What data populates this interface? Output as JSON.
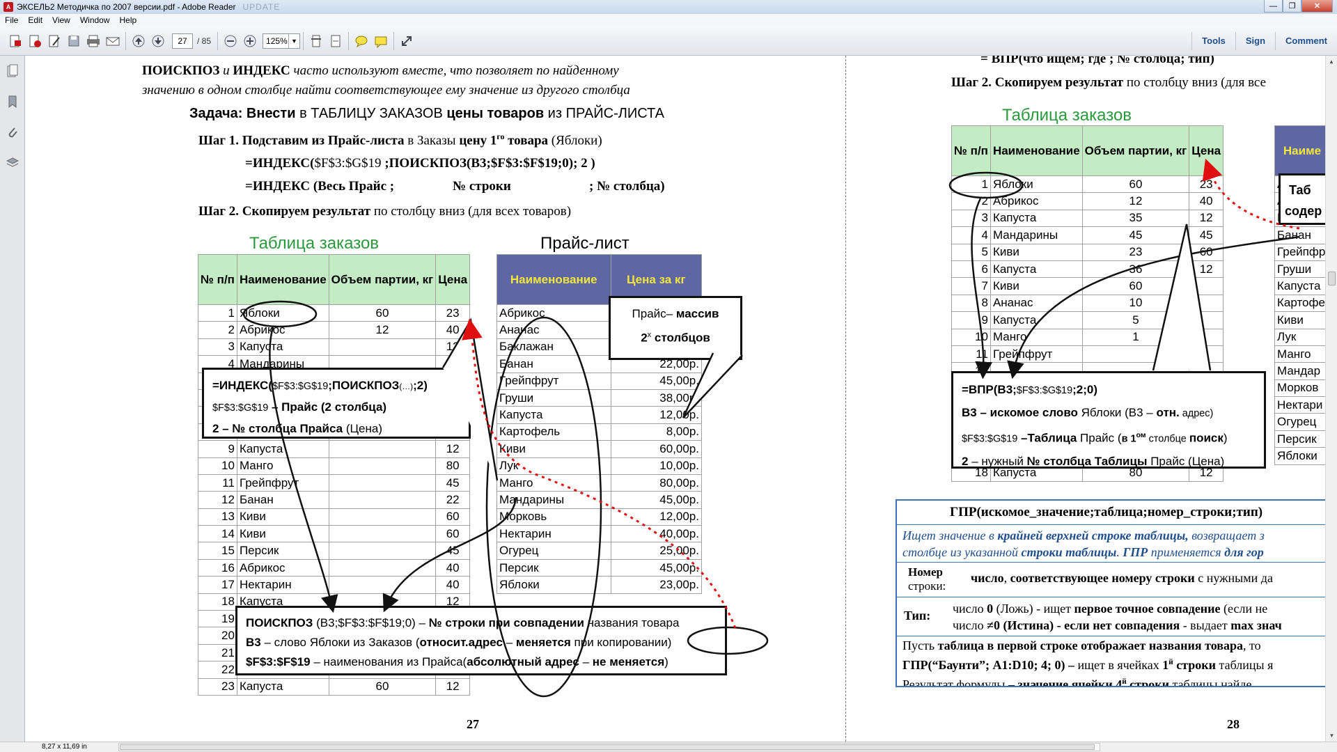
{
  "window": {
    "title": "ЭКСЕЛЬ2 Методичка по 2007 версии.pdf - Adobe Reader",
    "title_blur": "UPDATE"
  },
  "menu": [
    "File",
    "Edit",
    "View",
    "Window",
    "Help"
  ],
  "toolbar": {
    "page_current": "27",
    "page_total": "/ 85",
    "zoom": "125%",
    "links": [
      "Tools",
      "Sign",
      "Comment"
    ]
  },
  "status": {
    "page_size": "8,27 x 11,69 in"
  },
  "page27": {
    "intro_line1": [
      {
        "t": "ПОИСКПОЗ",
        "c": "b"
      },
      {
        "t": " и ",
        "c": "it"
      },
      {
        "t": "ИНДЕКС",
        "c": "b"
      },
      {
        "t": " часто используют вместе, что позволяет по найденному",
        "c": "it"
      }
    ],
    "intro_line2": "значению в одном столбце найти соответствующее ему значение из другого столбца",
    "task": [
      {
        "t": "Задача: Внести",
        "c": "b"
      },
      {
        "t": " в ТАБЛИЦУ ЗАКАЗОВ ",
        "c": ""
      },
      {
        "t": "цены товаров",
        "c": "b"
      },
      {
        "t": " из ПРАЙС-ЛИСТА",
        "c": ""
      }
    ],
    "step1": [
      {
        "t": "Шаг 1.  Подставим из Прайс-листа",
        "c": "b"
      },
      {
        "t": " в Заказы ",
        "c": ""
      },
      {
        "t": "цену 1",
        "c": "b"
      },
      {
        "t": "го",
        "c": "bsup"
      },
      {
        "t": " товара",
        "c": "b"
      },
      {
        "t": " (Яблоки)",
        "c": ""
      }
    ],
    "formula1": [
      {
        "t": "=ИНДЕКС(",
        "c": "b"
      },
      {
        "t": "$F$3:$G$19",
        "c": ""
      },
      {
        "t": " ;ПОИСКПОЗ(В3;$F$3:$F$19;0); 2 )",
        "c": "b"
      }
    ],
    "formula2a": "=ИНДЕКС (Весь Прайс ;",
    "formula2b": "№ строки",
    "formula2c": "; № столбца)",
    "step2": [
      {
        "t": "Шаг 2.  Скопируем результат",
        "c": "b"
      },
      {
        "t": " по столбцу вниз (для всех товаров)",
        "c": ""
      }
    ],
    "orders_title": "Таблица заказов",
    "orders_headers": [
      "№ п/п",
      "Наименование",
      "Объем партии, кг",
      "Цена"
    ],
    "orders_rows": [
      [
        "1",
        "Яблоки",
        "60",
        "23"
      ],
      [
        "2",
        "Абрикос",
        "12",
        "40"
      ],
      [
        "3",
        "Капуста",
        "",
        "12"
      ],
      [
        "4",
        "Мандарины",
        "",
        ""
      ],
      [
        "5",
        "",
        "",
        ""
      ],
      [
        "6",
        "",
        "",
        ""
      ],
      [
        "7",
        "",
        "",
        ""
      ],
      [
        "8",
        "",
        "",
        ""
      ],
      [
        "9",
        "Капуста",
        "",
        "12"
      ],
      [
        "10",
        "Манго",
        "",
        "80"
      ],
      [
        "11",
        "Грейпфрут",
        "",
        "45"
      ],
      [
        "12",
        "Банан",
        "",
        "22"
      ],
      [
        "13",
        "Киви",
        "",
        "60"
      ],
      [
        "14",
        "Киви",
        "",
        "60"
      ],
      [
        "15",
        "Персик",
        "",
        "45"
      ],
      [
        "16",
        "Абрикос",
        "",
        "40"
      ],
      [
        "17",
        "Нектарин",
        "",
        "40"
      ],
      [
        "18",
        "Капуста",
        "",
        "12"
      ],
      [
        "19",
        "",
        "",
        ""
      ],
      [
        "20",
        "",
        "",
        ""
      ],
      [
        "21",
        "",
        "",
        ""
      ],
      [
        "22",
        "",
        "",
        ""
      ],
      [
        "23",
        "Капуста",
        "60",
        "12"
      ]
    ],
    "price_title": "Прайс-лист",
    "price_headers": [
      "Наименование",
      "Цена за кг"
    ],
    "price_rows": [
      [
        "Абрикос",
        ""
      ],
      [
        "Ананас",
        ""
      ],
      [
        "Баклажан",
        "00р."
      ],
      [
        "Банан",
        "22,00р."
      ],
      [
        "Грейпфрут",
        "45,00р."
      ],
      [
        "Груши",
        "38,00р."
      ],
      [
        "Капуста",
        "12,00р."
      ],
      [
        "Картофель",
        "8,00р."
      ],
      [
        "Киви",
        "60,00р."
      ],
      [
        "Лук",
        "10,00р."
      ],
      [
        "Манго",
        "80,00р."
      ],
      [
        "Мандарины",
        "45,00р."
      ],
      [
        "Морковь",
        "12,00р."
      ],
      [
        "Нектарин",
        "40,00р."
      ],
      [
        "Огурец",
        "25,00р."
      ],
      [
        "Персик",
        "45,00р."
      ],
      [
        "Яблоки",
        "23,00р."
      ]
    ],
    "callout_price": {
      "l1a": "Прайс– ",
      "l1b": "массив",
      "l2": "2",
      "l2sup": "х",
      "l2b": " столбцов"
    },
    "callout_index": {
      "l1": [
        {
          "t": "=ИНДЕКС(",
          "c": "b"
        },
        {
          "t": "$F$3:$G$19",
          "c": "sm"
        },
        {
          "t": ";ПОИСКПОЗ",
          "c": "b"
        },
        {
          "t": "(…)",
          "c": "xs"
        },
        {
          "t": ";2)",
          "c": "b"
        }
      ],
      "l2": [
        {
          "t": "$F$3:$G$19",
          "c": "sm"
        },
        {
          "t": " – Прайс (2 столбца)",
          "c": "b"
        }
      ],
      "l3": [
        {
          "t": "2 – № столбца Прайса",
          "c": "b"
        },
        {
          "t": " (Цена)",
          "c": ""
        }
      ]
    },
    "callout_match": {
      "l1": [
        {
          "t": "ПОИСКПОЗ",
          "c": "b"
        },
        {
          "t": " (В3;$F$3:$F$19;0)  – ",
          "c": ""
        },
        {
          "t": "№ строки при совпадении",
          "c": "b"
        },
        {
          "t": " названия товара",
          "c": ""
        }
      ],
      "l2": [
        {
          "t": "В3",
          "c": "b"
        },
        {
          "t": " – слово Яблоки из Заказов (",
          "c": ""
        },
        {
          "t": "относит.адрес",
          "c": "b"
        },
        {
          "t": " – ",
          "c": ""
        },
        {
          "t": "меняется",
          "c": "b"
        },
        {
          "t": " при копировании)",
          "c": ""
        }
      ],
      "l3": [
        {
          "t": "$F$3:$F$19",
          "c": "b"
        },
        {
          "t": "  – наименования из Прайса(",
          "c": ""
        },
        {
          "t": "абсолютный адрес",
          "c": "b"
        },
        {
          "t": " – ",
          "c": ""
        },
        {
          "t": "не меняется",
          "c": "b"
        },
        {
          "t": ")",
          "c": ""
        }
      ]
    },
    "page_number": "27"
  },
  "page28": {
    "top_formula": [
      {
        "t": "= ВПР(",
        "c": "b"
      },
      {
        "t": "что ищем;",
        "c": "b"
      },
      {
        "t": "       где       ",
        "c": "b"
      },
      {
        "t": "; № столбца; тип)",
        "c": "b"
      }
    ],
    "step2": [
      {
        "t": "Шаг 2.  Скопируем результат",
        "c": "b"
      },
      {
        "t": " по столбцу вниз (для все",
        "c": ""
      }
    ],
    "orders_title": "Таблица заказов",
    "orders_headers": [
      "№ п/п",
      "Наименование",
      "Объем партии, кг",
      "Цена"
    ],
    "orders_rows": [
      [
        "1",
        "Яблоки",
        "60",
        "23"
      ],
      [
        "2",
        "Абрикос",
        "12",
        "40"
      ],
      [
        "3",
        "Капуста",
        "35",
        "12"
      ],
      [
        "4",
        "Мандарины",
        "45",
        "45"
      ],
      [
        "5",
        "Киви",
        "23",
        "60"
      ],
      [
        "6",
        "Капуста",
        "36",
        "12"
      ],
      [
        "7",
        "Киви",
        "60",
        ""
      ],
      [
        "8",
        "Ананас",
        "10",
        ""
      ],
      [
        "9",
        "Капуста",
        "5",
        ""
      ],
      [
        "10",
        "Манго",
        "1",
        ""
      ],
      [
        "11",
        "Грейпфрут",
        "",
        ""
      ],
      [
        "12",
        "",
        "",
        ""
      ],
      [
        "13",
        "",
        "",
        ""
      ],
      [
        "14",
        "",
        "",
        ""
      ],
      [
        "15",
        "",
        "",
        ""
      ],
      [
        "16",
        "",
        "",
        ""
      ],
      [
        "17",
        "",
        "",
        ""
      ],
      [
        "18",
        "Капуста",
        "80",
        "12"
      ]
    ],
    "price_header": "Наиме",
    "price_rows": [
      "Абр",
      "Ана",
      "Баклаж",
      "Банан",
      "Грейпфр",
      "Груши",
      "Капуста",
      "Картофе",
      "Киви",
      "Лук",
      "Манго",
      "Мандар",
      "Морков",
      "Нектари",
      "Огурец",
      "Персик",
      "Яблоки"
    ],
    "callout_tab": {
      "l1": "Таб",
      "l2": "содер"
    },
    "callout_vlookup": {
      "l1": [
        {
          "t": "=ВПР(В3;",
          "c": "b"
        },
        {
          "t": "$F$3:$G$19",
          "c": "sm"
        },
        {
          "t": ";2;0)",
          "c": "b"
        }
      ],
      "l2": [
        {
          "t": "В3",
          "c": "b"
        },
        {
          "t": " – искомое слово ",
          "c": "b"
        },
        {
          "t": "Яблоки (В3 – ",
          "c": ""
        },
        {
          "t": "отн.",
          "c": "b"
        },
        {
          "t": " адрес)",
          "c": "sm"
        }
      ],
      "l3": [
        {
          "t": "$F$3:$G$19",
          "c": "sm"
        },
        {
          "t": " –Таблица",
          "c": "b"
        },
        {
          "t": " Прайс (",
          "c": ""
        },
        {
          "t": "в 1",
          "c": "bs"
        },
        {
          "t": "ом",
          "c": "bsup"
        },
        {
          "t": " столбце ",
          "c": "sm"
        },
        {
          "t": "поиск",
          "c": "b"
        },
        {
          "t": ")",
          "c": ""
        }
      ],
      "l4": [
        {
          "t": "2",
          "c": "b"
        },
        {
          "t": " – нужный ",
          "c": ""
        },
        {
          "t": "№ столбца Таблицы",
          "c": "b"
        },
        {
          "t": " Прайс (Цена)",
          "c": ""
        }
      ]
    },
    "hlookup": {
      "title": "ГПР(искомое_значение;таблица;номер_строки;тип)",
      "desc1": [
        {
          "t": "Ищет значение в ",
          "c": "it blue"
        },
        {
          "t": "крайней верхней строке таблицы,",
          "c": "it b blue"
        },
        {
          "t": " возвращает з",
          "c": "it blue"
        }
      ],
      "desc2": [
        {
          "t": "столбце из указанной ",
          "c": "it blue"
        },
        {
          "t": "строки таблицы",
          "c": "it b blue"
        },
        {
          "t": ".  ",
          "c": "it blue"
        },
        {
          "t": "ГПР",
          "c": "it b blue"
        },
        {
          "t": " применяется ",
          "c": "it blue"
        },
        {
          "t": "для гор",
          "c": "it b blue"
        }
      ],
      "row_label1": "Номер",
      "row_label2": "строки:",
      "row_text": [
        {
          "t": "число",
          "c": "b"
        },
        {
          "t": ", ",
          "c": ""
        },
        {
          "t": "соответствующее номеру строки",
          "c": "b"
        },
        {
          "t": "  с нужными да",
          "c": ""
        }
      ],
      "type_label": "Тип:",
      "type1": [
        {
          "t": "число ",
          "c": ""
        },
        {
          "t": "0",
          "c": "b"
        },
        {
          "t": " (Ложь)  - ищет ",
          "c": ""
        },
        {
          "t": "первое точное совпадение",
          "c": "b"
        },
        {
          "t": " (если не",
          "c": ""
        }
      ],
      "type2": [
        {
          "t": "число ",
          "c": ""
        },
        {
          "t": "≠0 (Истина) - если нет совпадения",
          "c": "b"
        },
        {
          "t": " - выдает ",
          "c": ""
        },
        {
          "t": "max знач",
          "c": "b"
        }
      ],
      "ex1": [
        {
          "t": "Пусть ",
          "c": ""
        },
        {
          "t": "таблица в первой строке отображает названия товара",
          "c": "b"
        },
        {
          "t": ", то",
          "c": ""
        }
      ],
      "ex2": [
        {
          "t": "ГПР(“Баунти”; A1:D10; 4; 0) – ",
          "c": "b"
        },
        {
          "t": "ищет в ячейках ",
          "c": ""
        },
        {
          "t": "1",
          "c": "b"
        },
        {
          "t": "й",
          "c": "bsup"
        },
        {
          "t": " строки",
          "c": "b"
        },
        {
          "t": " таблицы я",
          "c": ""
        }
      ],
      "ex3": [
        {
          "t": "Результат формулы – ",
          "c": ""
        },
        {
          "t": "значение ячейки 4",
          "c": "b"
        },
        {
          "t": "й",
          "c": "bsup"
        },
        {
          "t": " строки",
          "c": "b"
        },
        {
          "t": " таблицы  найде",
          "c": ""
        }
      ]
    },
    "page_number": "28"
  },
  "colors": {
    "header_green": "#c4ecc4",
    "price_header_bg": "#5f66a4",
    "price_header_fg": "#f4e63a",
    "title_green": "#2a9a3c",
    "arrow_red": "#e01010"
  },
  "icons": [
    "create-pdf-icon",
    "open-icon",
    "edit-icon",
    "save-icon",
    "print-icon",
    "email-icon",
    "prev-page-icon",
    "next-page-icon",
    "zoom-out-icon",
    "zoom-in-icon",
    "fit-page-icon",
    "fit-width-icon",
    "comment-icon",
    "highlight-icon",
    "fullscreen-icon",
    "pages-panel-icon",
    "bookmarks-panel-icon",
    "attachments-panel-icon",
    "layers-panel-icon"
  ]
}
